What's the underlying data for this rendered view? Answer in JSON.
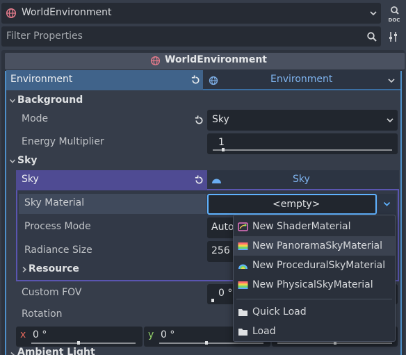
{
  "node_selector": {
    "name": "WorldEnvironment"
  },
  "filter": {
    "placeholder": "Filter Properties"
  },
  "inspector_header": {
    "title": "WorldEnvironment"
  },
  "environment_row": {
    "label": "Environment",
    "resource": "Environment"
  },
  "background_section": {
    "title": "Background",
    "mode": {
      "label": "Mode",
      "value": "Sky"
    },
    "energy": {
      "label": "Energy Multiplier",
      "value": "1",
      "fraction": 0.05
    }
  },
  "sky_section": {
    "title": "Sky",
    "sky_row": {
      "label": "Sky",
      "resource": "Sky"
    },
    "sky_material": {
      "label": "Sky Material",
      "value": "<empty>"
    },
    "process_mode": {
      "label": "Process Mode",
      "value": "Auto"
    },
    "radiance_size": {
      "label": "Radiance Size",
      "value": "256"
    },
    "resource": {
      "label": "Resource"
    },
    "custom_fov": {
      "label": "Custom FOV",
      "value": "0 °"
    },
    "rotation": {
      "label": "Rotation",
      "x": {
        "axis": "x",
        "value": "0 °"
      },
      "y": {
        "axis": "y",
        "value": "0 °"
      }
    }
  },
  "ambient_section": {
    "title": "Ambient Light"
  },
  "dropdown": {
    "items": [
      {
        "label": "New ShaderMaterial",
        "icon": "shader-material-icon"
      },
      {
        "label": "New PanoramaSkyMaterial",
        "icon": "panorama-sky-icon"
      },
      {
        "label": "New ProceduralSkyMaterial",
        "icon": "procedural-sky-icon"
      },
      {
        "label": "New PhysicalSkyMaterial",
        "icon": "physical-sky-icon"
      },
      {
        "label": "Quick Load",
        "icon": "folder-icon"
      },
      {
        "label": "Load",
        "icon": "folder-icon"
      }
    ]
  },
  "colors": {
    "panel": "#363d4a",
    "field": "#21262e",
    "environment_header": "#40638a",
    "sky_header": "#4f4b93",
    "accent": "#5fb2ff",
    "axis_x": "#e5695c",
    "axis_y": "#94d26a"
  }
}
